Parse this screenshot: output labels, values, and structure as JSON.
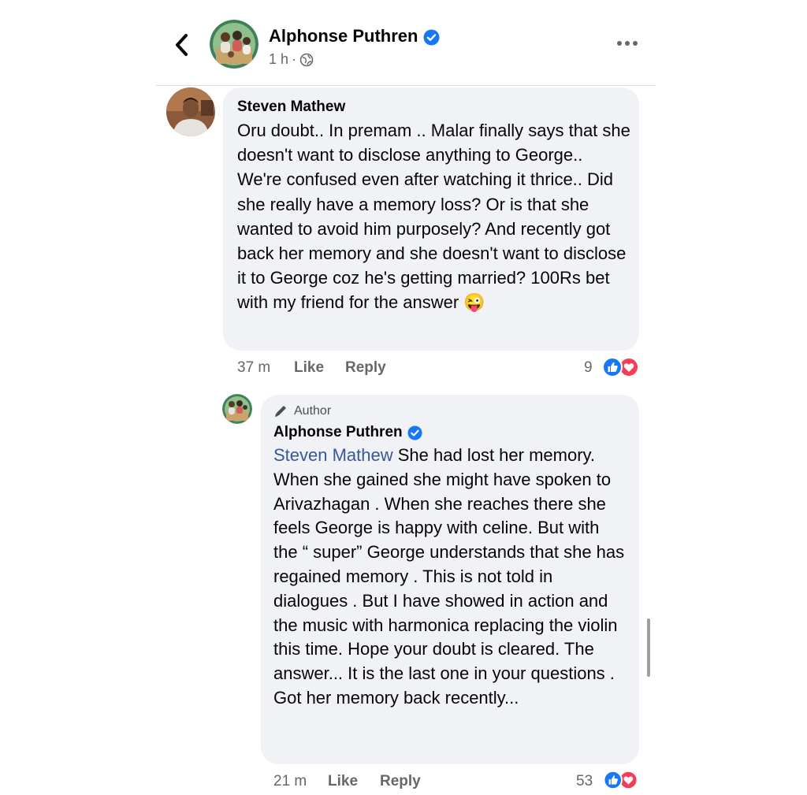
{
  "header": {
    "back_icon": "chevron-left-icon",
    "name": "Alphonse Puthren",
    "time": "1 h",
    "separator": "·",
    "audience_icon": "globe-icon",
    "more_icon": "more-horizontal-icon"
  },
  "comment": {
    "author": "Steven Mathew",
    "text": "Oru doubt.. In premam .. Malar finally says that she doesn't want to disclose anything to George.. We're confused even after watching it thrice.. Did she really have a memory loss? Or is that she wanted to avoid him purposely? And recently got back her memory and she doesn't want to disclose it to George coz he's getting married? 100Rs bet with my friend for the answer",
    "emoji": "😜",
    "time": "37 m",
    "like_label": "Like",
    "reply_label": "Reply",
    "reaction_count": "9"
  },
  "reply": {
    "badge": "Author",
    "author": "Alphonse Puthren",
    "mention": "Steven Mathew",
    "text": " She had lost her memory. When she gained she might have spoken to Arivazhagan . When she reaches there she feels George is happy with celine. But with the “ super” George understands that she has regained memory . This is not told in dialogues . But I have showed in action and the music with harmonica replacing the violin this time. Hope your doubt is cleared. The answer... It is the last one in your questions . Got her memory back recently...",
    "time": "21 m",
    "like_label": "Like",
    "reply_label": "Reply",
    "reaction_count": "53"
  },
  "colors": {
    "bubble": "#f0f2f5",
    "link": "#385898",
    "like_blue": "#1877f2",
    "love_red": "#f33e58",
    "muted": "#65676b"
  }
}
